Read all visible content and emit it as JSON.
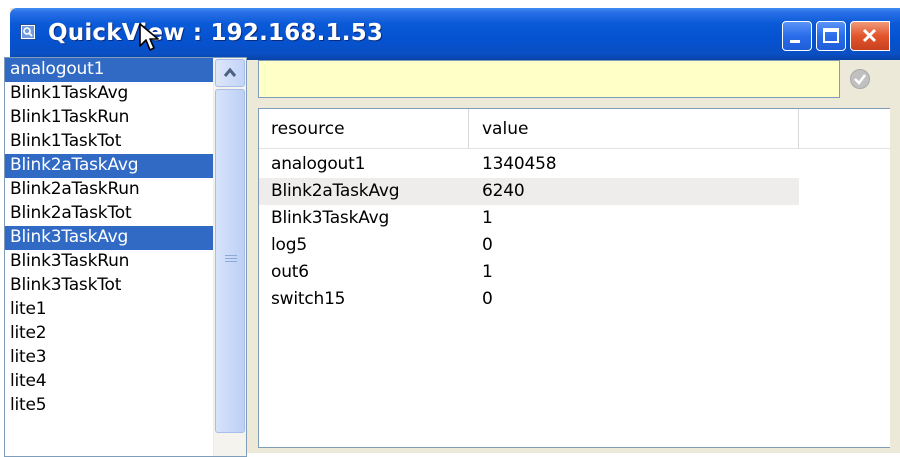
{
  "window": {
    "title": "QuickView : 192.168.1.53"
  },
  "list": {
    "items": [
      {
        "label": "analogout1",
        "selected": true
      },
      {
        "label": "Blink1TaskAvg",
        "selected": false
      },
      {
        "label": "Blink1TaskRun",
        "selected": false
      },
      {
        "label": "Blink1TaskTot",
        "selected": false
      },
      {
        "label": "Blink2aTaskAvg",
        "selected": true
      },
      {
        "label": "Blink2aTaskRun",
        "selected": false
      },
      {
        "label": "Blink2aTaskTot",
        "selected": false
      },
      {
        "label": "Blink3TaskAvg",
        "selected": true
      },
      {
        "label": "Blink3TaskRun",
        "selected": false
      },
      {
        "label": "Blink3TaskTot",
        "selected": false
      },
      {
        "label": "lite1",
        "selected": false
      },
      {
        "label": "lite2",
        "selected": false
      },
      {
        "label": "lite3",
        "selected": false
      },
      {
        "label": "lite4",
        "selected": false
      },
      {
        "label": "lite5",
        "selected": false
      }
    ]
  },
  "filter": {
    "value": "",
    "placeholder": ""
  },
  "table": {
    "columns": [
      "resource",
      "value"
    ],
    "rows": [
      {
        "resource": "analogout1",
        "value": "1340458",
        "highlighted": false
      },
      {
        "resource": "Blink2aTaskAvg",
        "value": "6240",
        "highlighted": true
      },
      {
        "resource": "Blink3TaskAvg",
        "value": "1",
        "highlighted": false
      },
      {
        "resource": "log5",
        "value": "0",
        "highlighted": false
      },
      {
        "resource": "out6",
        "value": "1",
        "highlighted": false
      },
      {
        "resource": "switch15",
        "value": "0",
        "highlighted": false
      }
    ]
  },
  "icons": {
    "app": "quickview-window-icon",
    "minimize": "minimize-icon",
    "maximize": "maximize-icon",
    "close": "close-icon",
    "apply": "checkmark-icon",
    "scroll_up": "scroll-up-arrow-icon",
    "cursor": "mouse-pointer-icon"
  },
  "colors": {
    "titlebar": "#0552d0",
    "selection": "#316ac5",
    "filter_background": "#ffffc8",
    "close_button": "#e2552d"
  }
}
